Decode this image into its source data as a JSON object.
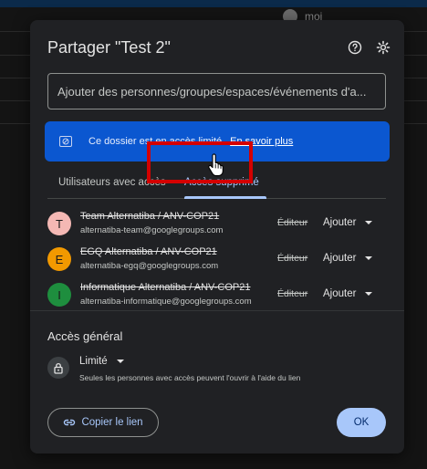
{
  "background": {
    "user_label": "moi"
  },
  "dialog": {
    "title": "Partager \"Test 2\"",
    "add_placeholder": "Ajouter des personnes/groupes/espaces/événements d'a...",
    "banner": {
      "text": "Ce dossier est en accès limité.",
      "link": "En savoir plus",
      "color": "#0b57d0"
    },
    "tabs": [
      {
        "label": "Utilisateurs avec accès"
      },
      {
        "label": "Accès supprimé"
      }
    ],
    "users": [
      {
        "initial": "T",
        "name": "Team Alternatiba / ANV-COP21",
        "email": "alternatiba-team@googlegroups.com",
        "old_role": "Éditeur",
        "action": "Ajouter",
        "avatar_color": "#f4b8b4"
      },
      {
        "initial": "E",
        "name": "EGQ Alternatiba / ANV-COP21",
        "email": "alternatiba-egq@googlegroups.com",
        "old_role": "Éditeur",
        "action": "Ajouter",
        "avatar_color": "#f29900"
      },
      {
        "initial": "I",
        "name": "Informatique Alternatiba / ANV-COP21",
        "email": "alternatiba-informatique@googlegroups.com",
        "old_role": "Éditeur",
        "action": "Ajouter",
        "avatar_color": "#1e8e3e"
      }
    ],
    "general_access": {
      "title": "Accès général",
      "level": "Limité",
      "description": "Seules les personnes avec accès peuvent l'ouvrir à l'aide du lien"
    },
    "copy_link_label": "Copier le lien",
    "ok_label": "OK",
    "highlight_color": "#d40000"
  }
}
